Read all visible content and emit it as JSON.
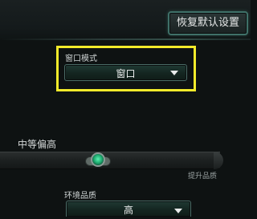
{
  "header": {
    "reset_button_label": "恢复默认设置"
  },
  "window_mode": {
    "label": "窗口模式",
    "value": "窗口"
  },
  "quality_slider": {
    "current_level": "中等偏高",
    "hint": "提升品质",
    "position_fraction": 0.43
  },
  "environment_quality": {
    "label": "环境品质",
    "value": "高"
  },
  "colors": {
    "highlight": "#f2ea2a",
    "accent": "#1fae72",
    "button_border": "#3f7068"
  },
  "icons": {
    "dropdown_caret": "caret-down-icon",
    "slider_knob": "slider-knob-icon"
  }
}
